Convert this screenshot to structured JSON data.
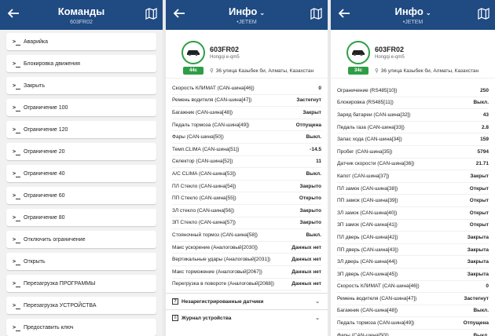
{
  "commands_panel": {
    "title": "Команды",
    "subtitle": "603FR02",
    "items": [
      "Аварийка",
      "Блокировка движения",
      "Закрыть",
      "Ограничение 100",
      "Ограничение 120",
      "Ограничение 20",
      "Ограничение 40",
      "Ограничение 60",
      "Ограничение 80",
      "Отключить ограничение",
      "Открыть",
      "Перезагрузка ПРОГРАММЫ",
      "Перезагрузка УСТРОЙСТВА",
      "Предоставить ключ"
    ]
  },
  "info_panel_1": {
    "title": "Инфо",
    "subtitle": "JETEM",
    "plate": "603FR02",
    "model": "Hongqi e-qm5",
    "badge": "44с",
    "address": "36 улица Казыбек би, Алматы, Казахстан",
    "rows": [
      {
        "label": "Скорость КЛИМАТ (CAN-шина[46])",
        "value": "0"
      },
      {
        "label": "Ремень водителя (CAN-шина[47])",
        "value": "Застегнут"
      },
      {
        "label": "Багажник (CAN-шина[48])",
        "value": "Закрыт"
      },
      {
        "label": "Педаль тормоза (CAN-шина[49])",
        "value": "Отпущена"
      },
      {
        "label": "Фары (CAN-шина[50])",
        "value": "Выкл."
      },
      {
        "label": "Темп.CLIMA (CAN-шина[51])",
        "value": "-14.5"
      },
      {
        "label": "Селектор (CAN-шина[52])",
        "value": "11"
      },
      {
        "label": "A/C CLIMA (CAN-шина[53])",
        "value": "Выкл."
      },
      {
        "label": "ПЛ Стекло (CAN-шина[54])",
        "value": "Закрыто"
      },
      {
        "label": "ПП Стекло (CAN-шина[55])",
        "value": "Открыто"
      },
      {
        "label": "ЗЛ стекло (CAN-шина[56])",
        "value": "Закрыто"
      },
      {
        "label": "ЗП Стекло (CAN-шина[57])",
        "value": "Закрыто"
      },
      {
        "label": "Стояночный тормоз (CAN-шина[58])",
        "value": "Выкл."
      },
      {
        "label": "Макс ускорение (Аналоговый[2030])",
        "value": "Данных нет"
      },
      {
        "label": "Вертикальные удары (Аналоговый[2031])",
        "value": "Данных нет"
      },
      {
        "label": "Макс торможение (Аналоговый[2067])",
        "value": "Данных нет"
      },
      {
        "label": "Перегрузка в повороте (Аналоговый[2068])",
        "value": "Данных нет"
      }
    ],
    "sections": [
      "Незарегистрированные датчики",
      "Журнал устройства"
    ]
  },
  "info_panel_2": {
    "title": "Инфо",
    "subtitle": "JETEM",
    "plate": "603FR02",
    "model": "Hongqi e-qm5",
    "badge": "34с",
    "address": "36 улица Казыбек би, Алматы, Казахстан",
    "rows": [
      {
        "label": "Ограничение (RS485[10])",
        "value": "250"
      },
      {
        "label": "Блокировка (RS485[11])",
        "value": "Выкл."
      },
      {
        "label": "Заряд батареи (CAN-шина[32])",
        "value": "43"
      },
      {
        "label": "Педаль газа (CAN-шина[33])",
        "value": "2.8"
      },
      {
        "label": "Запас хода (CAN-шина[34])",
        "value": "159"
      },
      {
        "label": "Пробег (CAN-шина[35])",
        "value": "5794"
      },
      {
        "label": "Датчик скорости (CAN-шина[36])",
        "value": "21.71"
      },
      {
        "label": "Капот (CAN-шина[37])",
        "value": "Закрыт"
      },
      {
        "label": "ПЛ замок (CAN-шина[38])",
        "value": "Открыт"
      },
      {
        "label": "ПП замок (CAN-шина[39])",
        "value": "Открыт"
      },
      {
        "label": "ЗЛ замок (CAN-шина[40])",
        "value": "Открыт"
      },
      {
        "label": "ЗП замок (CAN-шина[41])",
        "value": "Открыт"
      },
      {
        "label": "ПЛ дверь (CAN-шина[42])",
        "value": "Закрыта"
      },
      {
        "label": "ПП дверь (CAN-шина[43])",
        "value": "Закрыта"
      },
      {
        "label": "ЗЛ дверь (CAN-шина[44])",
        "value": "Закрыта"
      },
      {
        "label": "ЗП дверь (CAN-шина[45])",
        "value": "Закрыта"
      },
      {
        "label": "Скорость КЛИМАТ (CAN-шина[46])",
        "value": "0"
      },
      {
        "label": "Ремень водителя (CAN-шина[47])",
        "value": "Застегнут"
      },
      {
        "label": "Багажник (CAN-шина[48])",
        "value": "Выкл."
      },
      {
        "label": "Педаль тормоза (CAN-шина[49])",
        "value": "Отпущена"
      },
      {
        "label": "Фары (CAN-шина[50])",
        "value": "Выкл."
      }
    ]
  },
  "colors": {
    "header": "#1f4a82",
    "badge": "#2e9e46"
  },
  "icons": {
    "back": "arrow-left-icon",
    "map": "map-icon",
    "command": "terminal-icon"
  }
}
